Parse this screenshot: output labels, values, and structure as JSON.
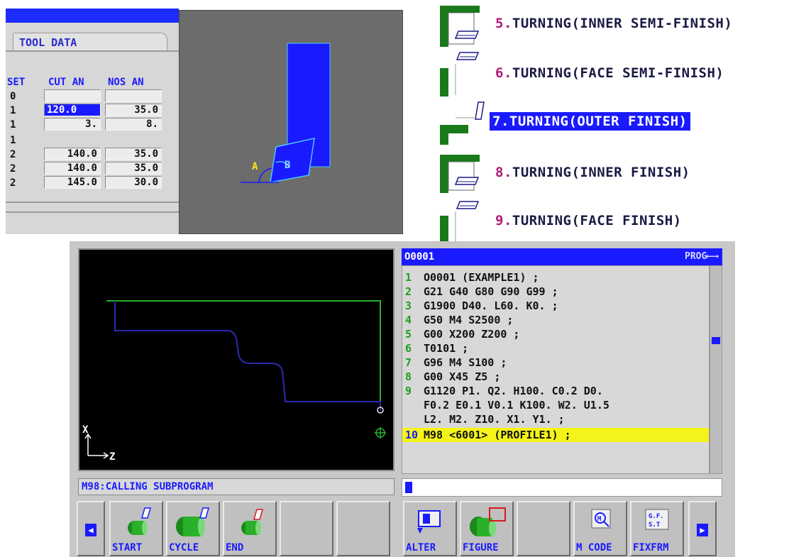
{
  "tool_data": {
    "tab_title": "TOOL DATA",
    "headers": {
      "set": "SET",
      "cut_an": "CUT AN",
      "nos_an": "NOS AN"
    },
    "rows": [
      {
        "set": "0",
        "cut": "",
        "nos": ""
      },
      {
        "set": "1",
        "cut": "120.0",
        "nos": "35.0"
      },
      {
        "set": "1",
        "cut": "3.",
        "nos": "8."
      },
      {
        "set": "1",
        "cut": "",
        "nos": ""
      },
      {
        "set": "2",
        "cut": "140.0",
        "nos": "35.0"
      },
      {
        "set": "2",
        "cut": "140.0",
        "nos": "35.0"
      },
      {
        "set": "2",
        "cut": "145.0",
        "nos": "30.0"
      }
    ]
  },
  "tool_graphic": {
    "label_a": "A",
    "label_b": "B"
  },
  "menu": [
    {
      "num": "5.",
      "text": "TURNING(INNER SEMI-FINISH)"
    },
    {
      "num": "6.",
      "text": "TURNING(FACE SEMI-FINISH)"
    },
    {
      "num": "7.",
      "text": "TURNING(OUTER FINISH)",
      "selected": true
    },
    {
      "num": "8.",
      "text": "TURNING(INNER FINISH)"
    },
    {
      "num": "9.",
      "text": "TURNING(FACE FINISH)"
    }
  ],
  "graph": {
    "axis_x": "X",
    "axis_z": "Z"
  },
  "message": "M98:CALLING SUBPROGRAM",
  "program": {
    "number": "O0001",
    "mode": "PROG⟵⟶",
    "lines": [
      {
        "n": "1",
        "code": "O0001 (EXAMPLE1) ;"
      },
      {
        "n": "2",
        "code": "G21 G40 G80 G90 G99 ;"
      },
      {
        "n": "3",
        "code": "G1900 D40. L60. K0. ;"
      },
      {
        "n": "4",
        "code": "G50 M4 S2500 ;"
      },
      {
        "n": "5",
        "code": "G00 X200 Z200 ;"
      },
      {
        "n": "6",
        "code": "T0101 ;"
      },
      {
        "n": "7",
        "code": "G96 M4 S100 ;"
      },
      {
        "n": "8",
        "code": "G00 X45 Z5 ;"
      },
      {
        "n": "9",
        "code": "G1120 P1. Q2. H100. C0.2 D0."
      },
      {
        "n": "",
        "code": "F0.2 E0.1 V0.1 K100. W2. U1.5"
      },
      {
        "n": "",
        "code": "L2. M2. Z10. X1. Y1. ;"
      },
      {
        "n": "10",
        "code": "M98 <6001> (PROFILE1) ;",
        "current": true
      }
    ]
  },
  "softkeys": {
    "start": "START",
    "cycle": "CYCLE",
    "end": "END",
    "alter": "ALTER",
    "figure": "FIGURE",
    "m_code": "M CODE",
    "fixfrm": "FIXFRM",
    "fixfrm_icon": "G.F.\nS.T"
  },
  "colors": {
    "accent": "#1a1aff",
    "highlight": "#f4f41a",
    "tool_green": "#1a7a1a",
    "path_blue": "#2a2ab0",
    "path_green": "#2ab02a"
  }
}
